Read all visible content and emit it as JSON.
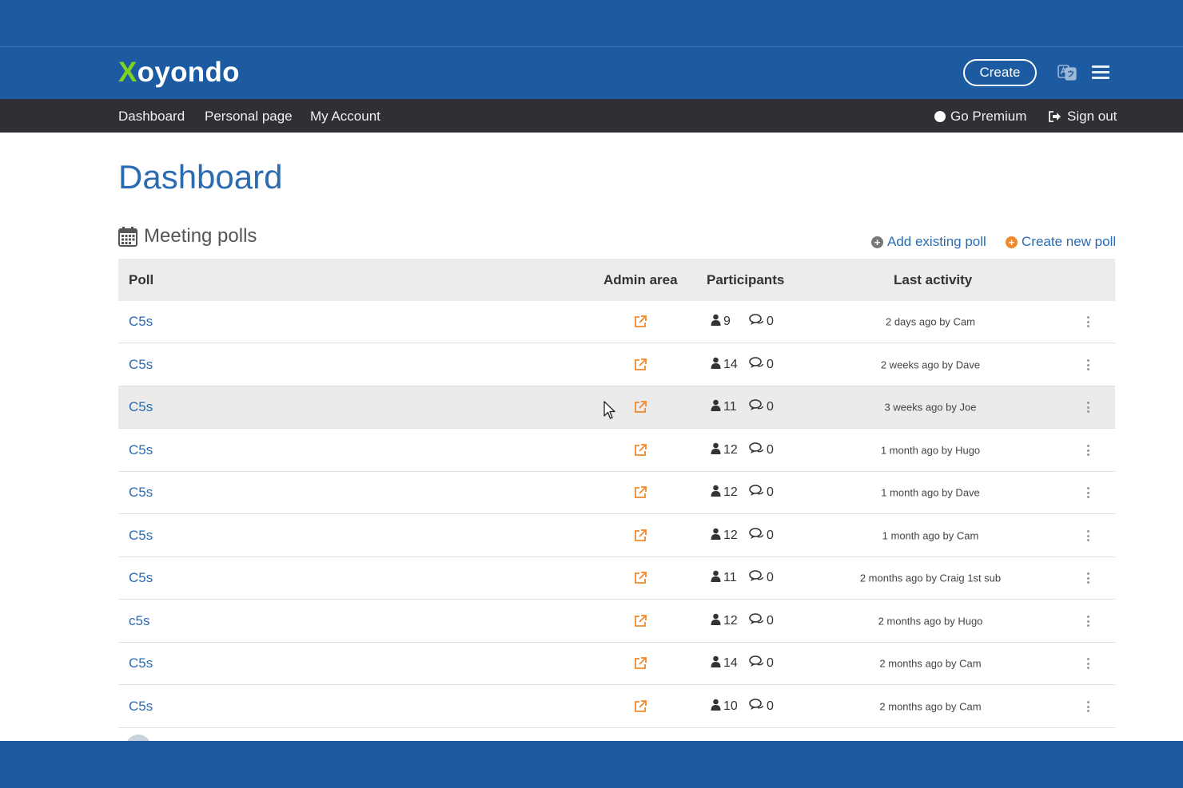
{
  "header": {
    "logo_x": "X",
    "logo_rest": "oyondo",
    "create_label": "Create",
    "icons": [
      "language-icon",
      "hamburger-menu-icon"
    ]
  },
  "nav": {
    "items": [
      "Dashboard",
      "Personal page",
      "My Account"
    ],
    "premium_label": "Go Premium",
    "signout_label": "Sign out"
  },
  "page": {
    "title": "Dashboard",
    "section_title": "Meeting polls",
    "add_existing_label": "Add existing poll",
    "create_new_label": "Create new poll"
  },
  "table": {
    "columns": [
      "Poll",
      "Admin area",
      "Participants",
      "Last activity"
    ],
    "rows": [
      {
        "poll": "C5s",
        "participants": "9",
        "comments": "0",
        "last_activity": "2 days ago by Cam"
      },
      {
        "poll": "C5s",
        "participants": "14",
        "comments": "0",
        "last_activity": "2 weeks ago by Dave"
      },
      {
        "poll": "C5s",
        "participants": "11",
        "comments": "0",
        "last_activity": "3 weeks ago by Joe"
      },
      {
        "poll": "C5s",
        "participants": "12",
        "comments": "0",
        "last_activity": "1 month ago by Hugo"
      },
      {
        "poll": "C5s",
        "participants": "12",
        "comments": "0",
        "last_activity": "1 month ago by Dave"
      },
      {
        "poll": "C5s",
        "participants": "12",
        "comments": "0",
        "last_activity": "1 month ago by Cam"
      },
      {
        "poll": "C5s",
        "participants": "11",
        "comments": "0",
        "last_activity": "2 months ago by Craig 1st sub"
      },
      {
        "poll": "c5s",
        "participants": "12",
        "comments": "0",
        "last_activity": "2 months ago by Hugo"
      },
      {
        "poll": "C5s",
        "participants": "14",
        "comments": "0",
        "last_activity": "2 months ago by Cam"
      },
      {
        "poll": "C5s",
        "participants": "10",
        "comments": "0",
        "last_activity": "2 months ago by Cam"
      }
    ]
  },
  "colors": {
    "brand_blue": "#1c5aa1",
    "logo_green": "#7ed321",
    "nav_dark": "#2f3033",
    "link_blue": "#2b6cb0",
    "admin_orange": "#f0892b",
    "create_orange": "#f0892b",
    "add_gray": "#777777"
  }
}
